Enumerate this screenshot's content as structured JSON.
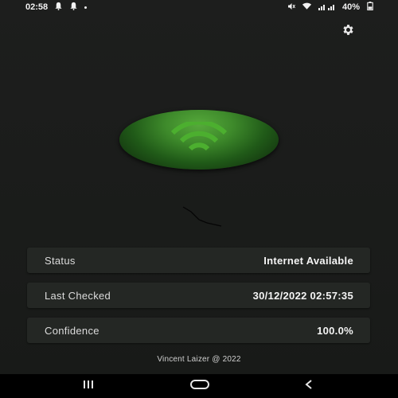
{
  "status_bar": {
    "time": "02:58",
    "battery_percent": "40%",
    "left_icons": [
      "bell-icon",
      "bell-icon",
      "dot-icon"
    ],
    "right_icons": [
      "mute-icon",
      "wifi-signal-icon",
      "cell-signal-icon",
      "battery-icon"
    ]
  },
  "header": {
    "settings_icon": "gear-icon"
  },
  "wifi_button": {
    "icon": "wifi-icon",
    "accent_color": "#4caf2f"
  },
  "info": {
    "status": {
      "label": "Status",
      "value": "Internet Available"
    },
    "last_checked": {
      "label": "Last Checked",
      "value": "30/12/2022 02:57:35"
    },
    "confidence": {
      "label": "Confidence",
      "value": "100.0%"
    }
  },
  "footer": {
    "credit": "Vincent Laizer @ 2022"
  },
  "nav_bar": {
    "icons": [
      "recent-apps-icon",
      "home-icon",
      "back-icon"
    ]
  }
}
